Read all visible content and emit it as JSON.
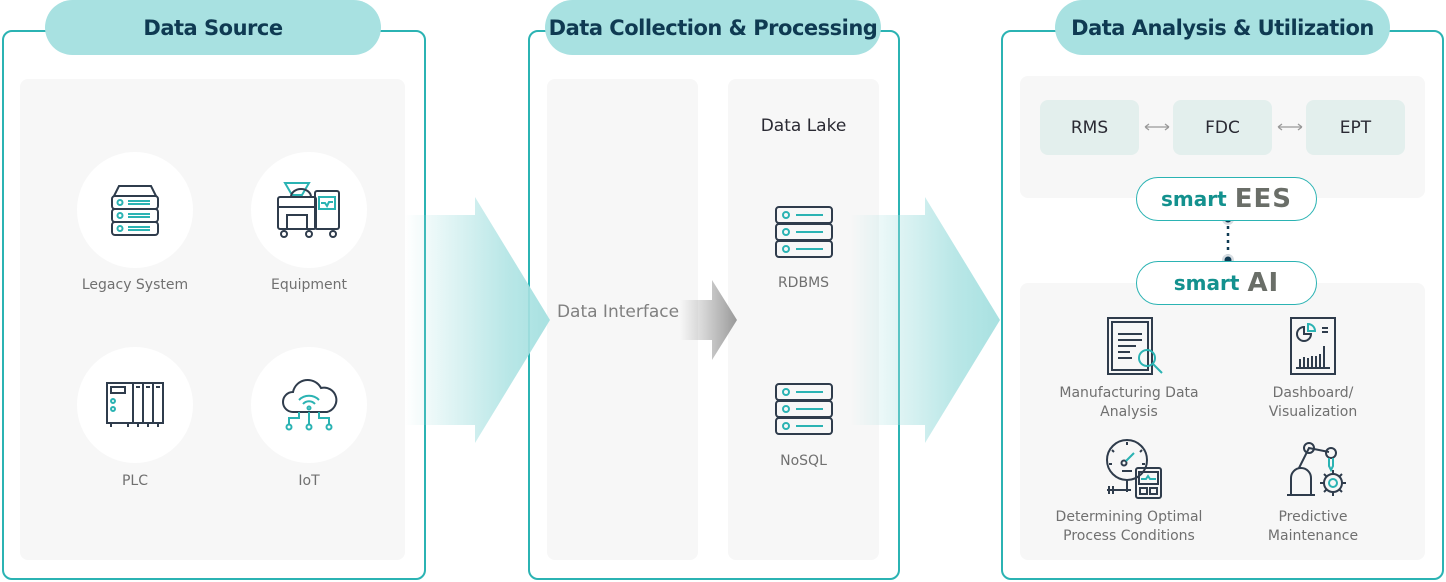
{
  "colors": {
    "accent": "#2bb3b3",
    "pill": "#a8e1e1",
    "title": "#0f3a52",
    "panel_bg": "#f7f7f7",
    "box_bg": "#e3efed",
    "logo_teal": "#13918e",
    "logo_gray": "#6a6e68"
  },
  "sections": [
    {
      "title": "Data Source",
      "items": [
        {
          "label": "Legacy System",
          "icon": "server-icon"
        },
        {
          "label": "Equipment",
          "icon": "equipment-icon"
        },
        {
          "label": "PLC",
          "icon": "plc-icon"
        },
        {
          "label": "IoT",
          "icon": "cloud-iot-icon"
        }
      ]
    },
    {
      "title": "Data Collection & Processing",
      "interface": "Data Interface",
      "lake": {
        "title": "Data Lake",
        "items": [
          {
            "label": "RDBMS",
            "icon": "database-icon"
          },
          {
            "label": "NoSQL",
            "icon": "database-icon"
          }
        ]
      }
    },
    {
      "title": "Data Analysis & Utilization",
      "systems": [
        "RMS",
        "FDC",
        "EPT"
      ],
      "logos": [
        {
          "prefix": "smart",
          "name": "EES"
        },
        {
          "prefix": "smart",
          "name": "AI"
        }
      ],
      "items": [
        {
          "label": "Manufacturing Data Analysis",
          "icon": "document-search-icon"
        },
        {
          "label": "Dashboard/ Visualization",
          "icon": "dashboard-icon"
        },
        {
          "label": "Determining Optimal Process Conditions",
          "icon": "gauge-icon"
        },
        {
          "label": "Predictive Maintenance",
          "icon": "robot-arm-gear-icon"
        }
      ]
    }
  ]
}
